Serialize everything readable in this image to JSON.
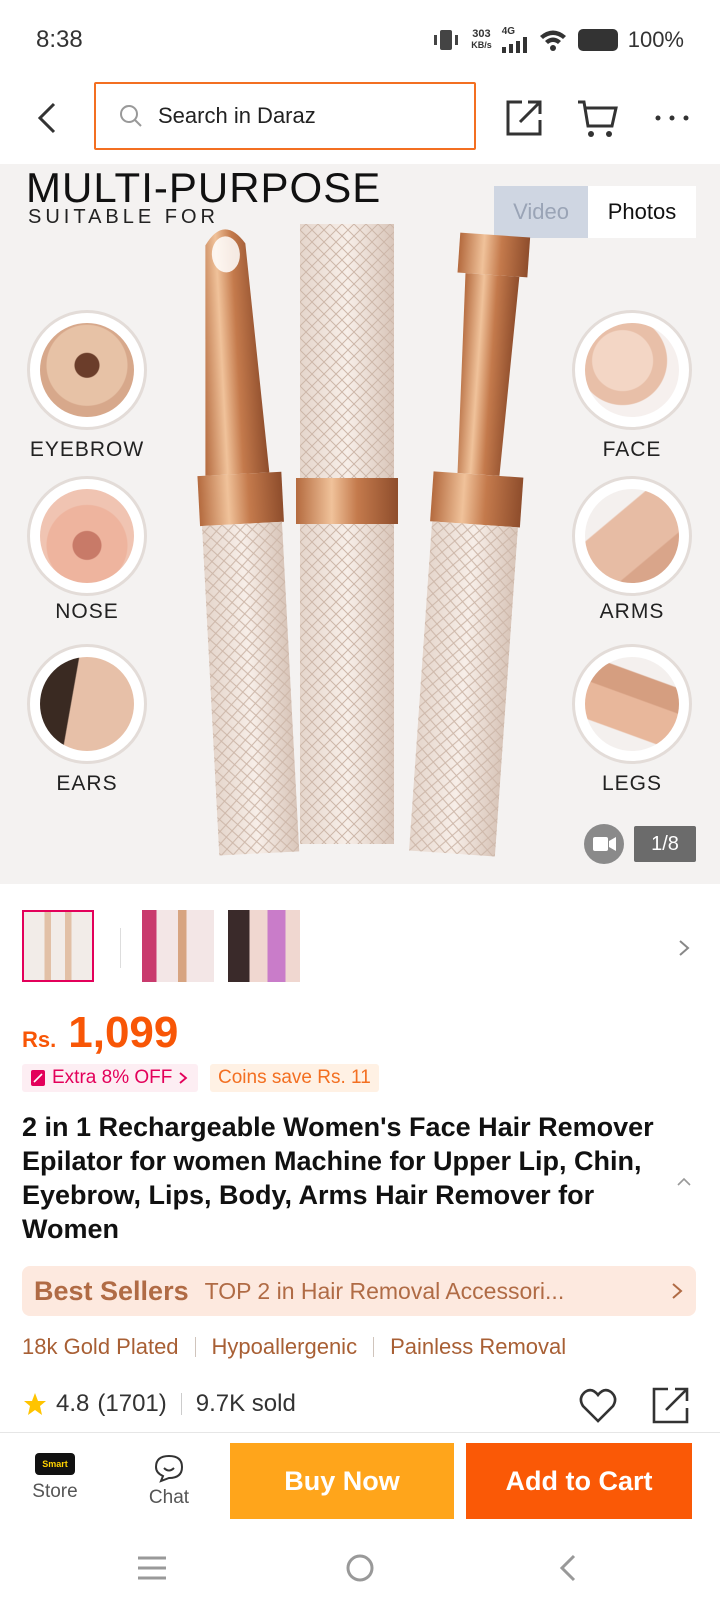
{
  "status": {
    "time": "8:38",
    "speed_value": "303",
    "speed_unit": "KB/s",
    "network": "4G",
    "battery": "100%"
  },
  "header": {
    "search_placeholder": "Search in Daraz"
  },
  "hero": {
    "heading": "MULTI-PURPOSE",
    "subheading": "SUITABLE FOR",
    "toggle_video": "Video",
    "toggle_photos": "Photos",
    "labels": {
      "eyebrow": "EYEBROW",
      "nose": "NOSE",
      "ears": "EARS",
      "face": "FACE",
      "arms": "ARMS",
      "legs": "LEGS"
    },
    "pager": "1/8"
  },
  "price": {
    "currency": "Rs.",
    "amount": "1,099"
  },
  "promos": {
    "extra_off": "Extra 8% OFF",
    "coins": "Coins save Rs. 11"
  },
  "product": {
    "title": "2 in 1 Rechargeable Women's Face Hair Remover Epilator for women Machine for Upper Lip, Chin, Eyebrow, Lips, Body, Arms Hair Remover for Women"
  },
  "best_sellers": {
    "label": "Best Sellers",
    "text": "TOP 2 in Hair Removal Accessori..."
  },
  "features": [
    "18k Gold Plated",
    "Hypoallergenic",
    "Painless Removal"
  ],
  "rating": {
    "score": "4.8",
    "count": "(1701)",
    "sold": "9.7K sold"
  },
  "bottom": {
    "store": "Store",
    "store_logo": "Smart",
    "chat": "Chat",
    "buy_now": "Buy Now",
    "add_to_cart": "Add to Cart"
  },
  "colors": {
    "brand": "#f85606",
    "buy": "#ffa51b",
    "cart": "#fa5906",
    "accent_pink": "#e3005a"
  }
}
